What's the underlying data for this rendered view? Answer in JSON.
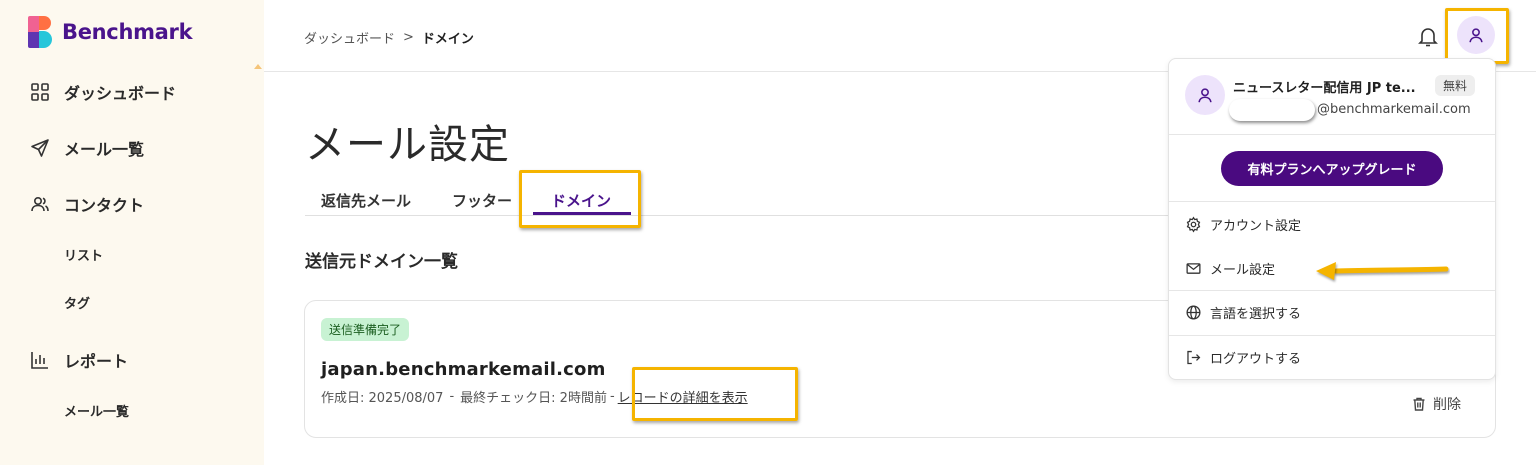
{
  "app": {
    "logo_text": "Benchmark"
  },
  "sidebar": {
    "items": [
      {
        "label": "ダッシュボード",
        "icon": "grid-icon"
      },
      {
        "label": "メール一覧",
        "icon": "send-icon"
      },
      {
        "label": "コンタクト",
        "icon": "users-icon"
      },
      {
        "label": "リスト"
      },
      {
        "label": "タグ"
      },
      {
        "label": "レポート",
        "icon": "bar-chart-icon"
      },
      {
        "label": "メール一覧"
      }
    ]
  },
  "header": {
    "breadcrumb": {
      "parent": "ダッシュボード",
      "separator": ">",
      "current": "ドメイン"
    }
  },
  "main": {
    "title": "メール設定",
    "tabs": [
      {
        "label": "返信先メール"
      },
      {
        "label": "フッター"
      },
      {
        "label": "ドメイン",
        "active": true
      }
    ],
    "section_title": "送信元ドメイン一覧",
    "domain_card": {
      "status_badge": "送信準備完了",
      "domain": "japan.benchmarkemail.com",
      "created": "作成日: 2025/08/07",
      "separator": "-",
      "last_check": "最終チェック日: 2時間前",
      "details_link": "レコードの詳細を表示",
      "delete_label": "削除"
    }
  },
  "user_menu": {
    "account_name": "ニュースレター配信用 JP te...",
    "plan_badge": "無料",
    "email_suffix": "@benchmarkemail.com",
    "upgrade_label": "有料プランへアップグレード",
    "items": [
      {
        "label": "アカウント設定",
        "icon": "gear-icon"
      },
      {
        "label": "メール設定",
        "icon": "mail-icon"
      },
      {
        "label": "言語を選択する",
        "icon": "globe-icon"
      },
      {
        "label": "ログアウトする",
        "icon": "logout-icon"
      }
    ]
  },
  "colors": {
    "brand_purple": "#4a148c",
    "sidebar_bg": "#fdf9ef",
    "highlight": "#f5b400",
    "badge_green": "#c8f2d3"
  }
}
